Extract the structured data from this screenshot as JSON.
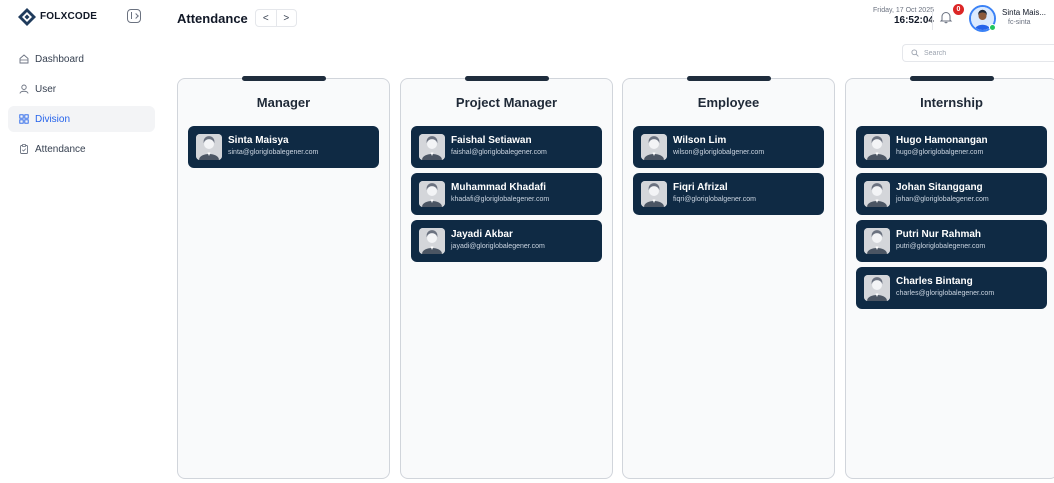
{
  "brand": {
    "name": "FOLXCODE"
  },
  "sidebar": {
    "items": [
      {
        "label": "Dashboard",
        "icon": "home-icon",
        "active": false
      },
      {
        "label": "User",
        "icon": "user-icon",
        "active": false
      },
      {
        "label": "Division",
        "icon": "division-icon",
        "active": true
      },
      {
        "label": "Attendance",
        "icon": "clipboard-icon",
        "active": false
      }
    ]
  },
  "header": {
    "title": "Attendance",
    "prev_label": "<",
    "next_label": ">",
    "date": "Friday, 17 Oct 2025",
    "time": "16:52:04",
    "notification_count": "0",
    "user_name": "Sinta Mais...",
    "user_handle": "fc-sinta"
  },
  "search": {
    "placeholder": "Search",
    "value": ""
  },
  "columns": [
    {
      "title": "Manager",
      "members": [
        {
          "name": "Sinta Maisya",
          "email": "sinta@gloriglobalegener.com"
        }
      ]
    },
    {
      "title": "Project Manager",
      "members": [
        {
          "name": "Faishal Setiawan",
          "email": "faishal@gloriglobalegener.com"
        },
        {
          "name": "Muhammad Khadafi",
          "email": "khadafi@gloriglobalegener.com"
        },
        {
          "name": "Jayadi Akbar",
          "email": "jayadi@gloriglobalegener.com"
        }
      ]
    },
    {
      "title": "Employee",
      "members": [
        {
          "name": "Wilson Lim",
          "email": "wilson@gloriglobalgener.com"
        },
        {
          "name": "Fiqri Afrizal",
          "email": "fiqri@gloriglobalgener.com"
        }
      ]
    },
    {
      "title": "Internship",
      "members": [
        {
          "name": "Hugo Hamonangan",
          "email": "hugo@gloriglobalgener.com"
        },
        {
          "name": "Johan Sitanggang",
          "email": "johan@gloriglobalegener.com"
        },
        {
          "name": "Putri Nur Rahmah",
          "email": "putri@gloriglobalegener.com"
        },
        {
          "name": "Charles Bintang",
          "email": "charles@gloriglobalegener.com"
        }
      ]
    }
  ],
  "colors": {
    "accent": "#2563eb",
    "card_bg": "#0f2a44",
    "badge": "#dc2626",
    "online": "#22c55e"
  }
}
